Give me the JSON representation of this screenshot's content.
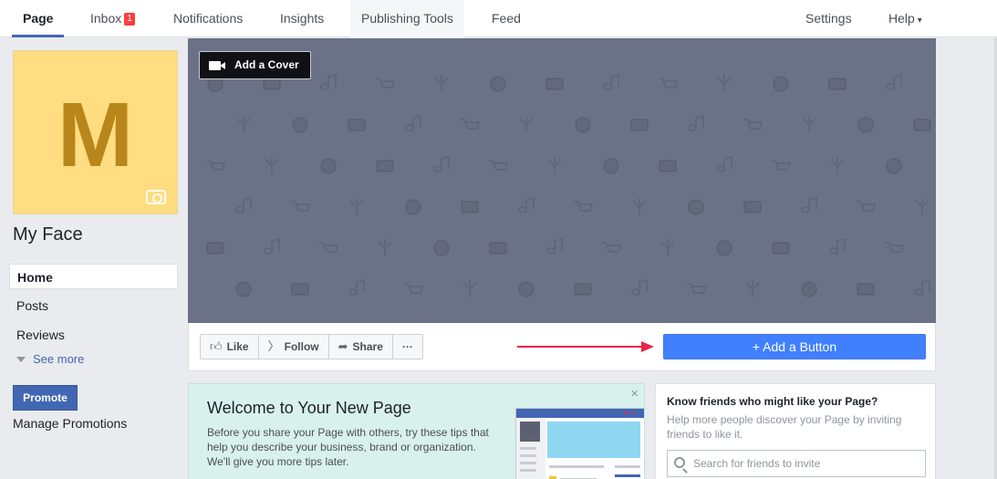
{
  "topbar": {
    "tabs": [
      {
        "label": "Page",
        "active": true
      },
      {
        "label": "Inbox",
        "badge": "1"
      },
      {
        "label": "Notifications"
      },
      {
        "label": "Insights"
      },
      {
        "label": "Publishing Tools"
      },
      {
        "label": "Feed"
      }
    ],
    "settings_label": "Settings",
    "help_label": "Help",
    "help_caret": "▾"
  },
  "profile": {
    "avatar_letter": "M",
    "page_name": "My Face"
  },
  "sidebar": {
    "items": [
      {
        "label": "Home",
        "active": true
      },
      {
        "label": "Posts"
      },
      {
        "label": "Reviews"
      }
    ],
    "see_more": "See more",
    "promote": "Promote",
    "manage_promotions": "Manage Promotions"
  },
  "cover": {
    "add_cover_label": "Add a Cover"
  },
  "actions": {
    "like": "Like",
    "follow": "Follow",
    "share": "Share",
    "more": "···",
    "add_button": "+ Add a Button"
  },
  "welcome": {
    "title": "Welcome to Your New Page",
    "body": "Before you share your Page with others, try these tips that help you describe your business, brand or organization. We'll give you more tips later.",
    "close": "×"
  },
  "friends": {
    "title": "Know friends who might like your Page?",
    "description": "Help more people discover your Page by inviting friends to like it.",
    "search_placeholder": "Search for friends to invite"
  },
  "colors": {
    "brand_blue": "#4267b2",
    "add_button_blue": "#4080ff",
    "cover_gray": "#6b7287",
    "avatar_yellow": "#ffdd80",
    "arrow_red": "#e8254a",
    "badge_red": "#fa3e3e"
  }
}
